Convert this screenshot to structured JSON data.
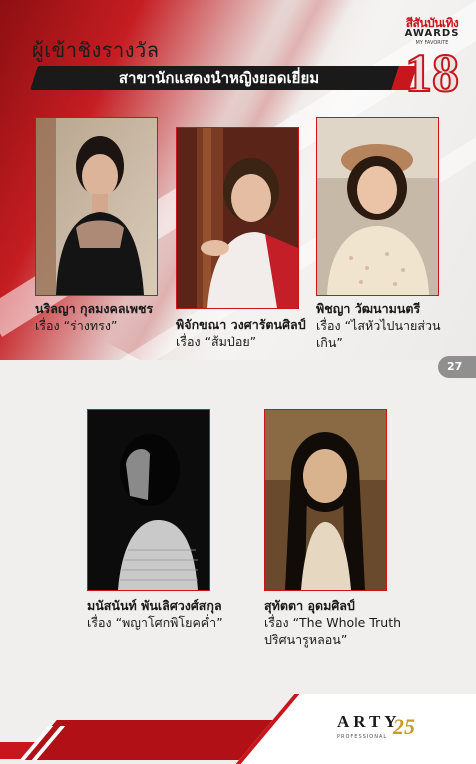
{
  "header": {
    "nominee_label": "ผู้เข้าชิงรางวัล",
    "category": "สาขานักแสดงนำหญิงยอดเยี่ยม"
  },
  "logo": {
    "brand": "สีสันบันเทิง",
    "awards": "AWARDS",
    "favorite": "MY FAVORITE",
    "edition": "18"
  },
  "page_number": "27",
  "nominees": [
    {
      "name": "นริลญา กุลมงคลเพชร",
      "title": "เรื่อง “ร่างทรง”"
    },
    {
      "name": "พิจักขณา วงศารัตนศิลป์",
      "title": "เรื่อง “ส้มป่อย”"
    },
    {
      "name": "พิชญา วัฒนามนตรี",
      "title": "เรื่อง “ไสหัวไปนายส่วนเกิน”"
    },
    {
      "name": "มนัสนันท์ พันเลิศวงศ์สกุล",
      "title": "เรื่อง “พญาโศกพิโยคค่ำ”"
    },
    {
      "name": "สุทัตตา อุดมศิลป์",
      "title": "เรื่อง “The Whole Truth",
      "title2": "ปริศนารูหลอน”"
    }
  ],
  "footer": {
    "brand": "ARTY",
    "sub": "PROFESSIONAL",
    "years": "25"
  },
  "colors": {
    "accent": "#c8161d",
    "dark": "#1a1a1a",
    "page": "#f1efee"
  }
}
